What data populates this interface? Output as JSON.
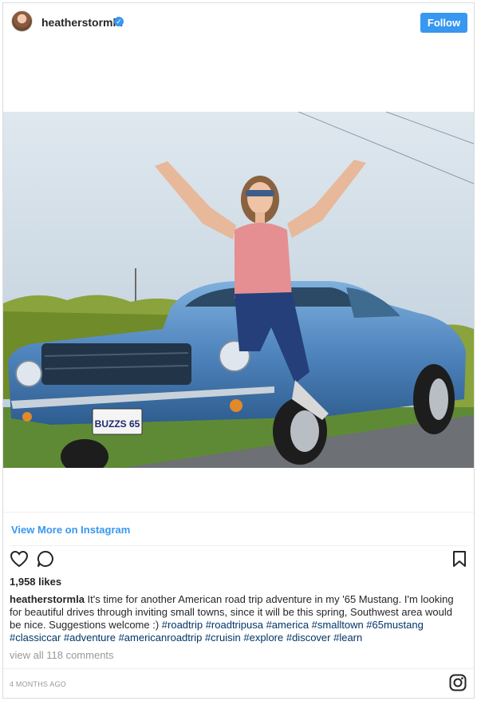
{
  "header": {
    "username": "heatherstormla",
    "verified_icon": "verified-badge-icon",
    "follow_label": "Follow"
  },
  "media": {
    "description_icon": "post-photo",
    "plate_text": "BUZZS 65"
  },
  "links": {
    "view_more": "View More on Instagram"
  },
  "actions": {
    "like_icon": "heart-icon",
    "comment_icon": "comment-icon",
    "save_icon": "bookmark-icon"
  },
  "post": {
    "likes": "1,958 likes",
    "caption_user": "heatherstormla",
    "caption_text": "It's time for another American road trip adventure in my '65 Mustang. I'm looking for beautiful drives through inviting small towns, since it will be this spring, Southwest area would be nice. Suggestions welcome :)",
    "hashtags": "#roadtrip #roadtripusa #america #smalltown #65mustang #classiccar #adventure #americanroadtrip #cruisin #explore #discover #learn",
    "comments_link": "view all 118 comments",
    "timestamp": "4 MONTHS AGO"
  },
  "colors": {
    "accent": "#3897f0",
    "hashtag": "#003569",
    "muted": "#999999",
    "car_blue": "#5b8fc4"
  }
}
